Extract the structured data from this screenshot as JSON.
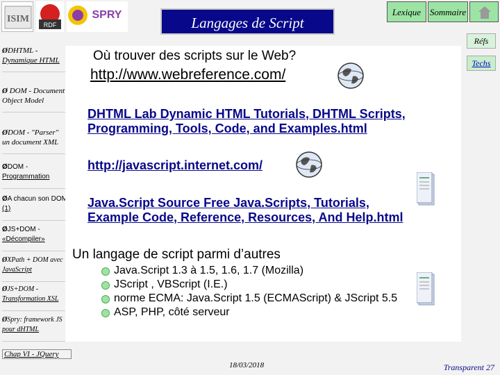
{
  "header": {
    "title": "Langages de Script",
    "lexique_label": "Lexique",
    "sommaire_label": "Sommaire",
    "refs_label": "Réfs",
    "techs_label": "Techs",
    "logo_text_1": "ISIM",
    "logo_text_2": "RDF",
    "logo_text_3": "SPRY"
  },
  "nav": {
    "items": [
      {
        "line1": "DHTML -",
        "line2": "Dynamique HTML",
        "style": "serif-ital"
      },
      {
        "line1": "DOM - Document",
        "line2": "Object Model",
        "style": "serif-ital"
      },
      {
        "line1": "DOM - \"Parser\"",
        "line2": "un document XML",
        "style": "serif-ital"
      },
      {
        "line1": "DOM -",
        "line2": "Programmation",
        "style": "sans"
      },
      {
        "line1": "A chacun son DOM",
        "line2": "(1)",
        "style": "sans"
      },
      {
        "line1": "JS+DOM -",
        "line2": "«Décompiler»",
        "style": "sans"
      },
      {
        "line1": "XPath + DOM avec",
        "line2": "JavaScript",
        "style": "serif-ital"
      },
      {
        "line1": "JS+DOM -",
        "line2": "Transformation XSL",
        "style": "serif-ital"
      },
      {
        "line1": "Spry: framework JS",
        "line2": "pour dHTML",
        "style": "serif-ital"
      }
    ],
    "chap_link": "Chap VI - JQuery"
  },
  "main": {
    "question": "Où trouver des scripts sur le Web?",
    "url1": "http://www.webreference.com/",
    "link1_line1": "DHTML Lab  Dynamic HTML Tutorials, DHTML Scripts,",
    "link1_line2": "Programming, Tools, Code, and Examples.html",
    "url2": "http://javascript.internet.com/",
    "link2_line1": "Java.Script Source  Free Java.Scripts, Tutorials,",
    "link2_line2": "Example Code, Reference, Resources, And Help.html",
    "section_title": "Un langage de script parmi d’autres",
    "bullets": [
      "Java.Script 1.3 à 1.5, 1.6, 1.7 (Mozilla)",
      "JScript , VBScript (I.E.)",
      "norme ECMA: Java.Script 1.5 (ECMAScript) & JScript 5.5",
      "ASP, PHP, côté serveur"
    ]
  },
  "footer": {
    "date": "18/03/2018",
    "page": "Transparent 27"
  },
  "colors": {
    "title_bg": "#08088a",
    "button_bg": "#9de4a4",
    "link_color": "#08088a"
  }
}
